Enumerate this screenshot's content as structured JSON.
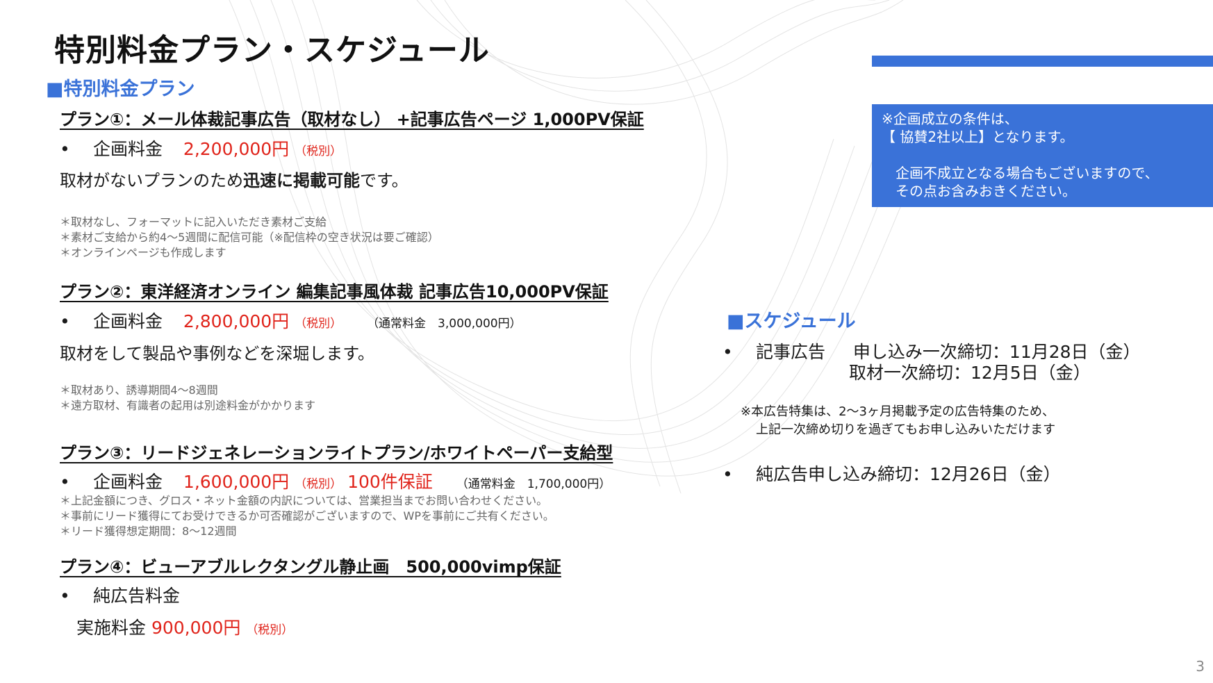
{
  "title": "特別料金プラン・スケジュール",
  "plans_heading": "■特別料金プラン",
  "plan1": {
    "heading": "プラン①：メール体裁記事広告（取材なし） +記事広告ページ 1,000PV保証",
    "fee_label": "企画料金",
    "fee_value": "2,200,000円",
    "fee_tax": "（税別）",
    "desc_pre": "取材がないプランのため",
    "desc_bold": "迅速に掲載可能",
    "desc_post": "です。",
    "notes": [
      "＊取材なし、フォーマットに記入いただき素材ご支給",
      "＊素材ご支給から約4～5週間に配信可能（※配信枠の空き状況は要ご確認）",
      "＊オンラインページも作成します"
    ]
  },
  "plan2": {
    "heading": "プラン②：東洋経済オンライン 編集記事風体裁 記事広告10,000PV保証",
    "fee_label": "企画料金",
    "fee_value": "2,800,000円",
    "fee_tax": "（税別）",
    "regular": "（通常料金　3,000,000円）",
    "desc": "取材をして製品や事例などを深堀します。",
    "notes": [
      "＊取材あり、誘導期間4～8週間",
      "＊遠方取材、有識者の起用は別途料金がかかります"
    ]
  },
  "plan3": {
    "heading": "プラン③：リードジェネレーションライトプラン/ホワイトペーパー支給型",
    "fee_label": "企画料金",
    "fee_value": "1,600,000円",
    "fee_tax": "（税別）",
    "guarantee": "100件保証",
    "regular": "（通常料金　1,700,000円）",
    "notes": [
      "＊上記金額につき、グロス・ネット金額の内訳については、営業担当までお問い合わせください。",
      "＊事前にリード獲得にてお受けできるか可否確認がございますので、WPを事前にご共有ください。",
      "＊リード獲得想定期間：8～12週間"
    ]
  },
  "plan4": {
    "heading": "プラン④：ビューアブルレクタングル静止画　500,000vimp保証",
    "fee_label": "純広告料金",
    "impl_label": "実施料金",
    "fee_value": "900,000円",
    "fee_tax": "（税別）"
  },
  "callout": {
    "line1": "※企画成立の条件は、",
    "line2": "【 協賛2社以上】となります。",
    "line3": "企画不成立となる場合もございますので、",
    "line4": "その点お含みおきください。"
  },
  "schedule": {
    "heading": "■スケジュール",
    "item1_label": "記事広告",
    "item1_line1": "申し込み一次締切：11月28日（金）",
    "item1_line2": "取材一次締切：12月5日（金）",
    "note_line1": "※本広告特集は、2～3ヶ月掲載予定の広告特集のため、",
    "note_line2": "上記一次締め切りを過ぎてもお申し込みいただけます",
    "item2": "純広告申し込み締切：12月26日（金）"
  },
  "page_number": "3",
  "colors": {
    "accent": "#3a72d8",
    "price": "#e0241b"
  }
}
